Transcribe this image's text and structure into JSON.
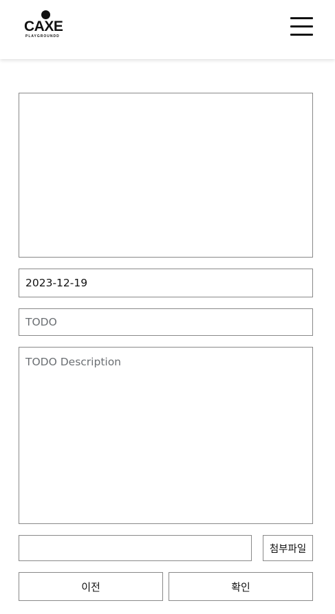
{
  "header": {
    "logo_text": "CAXE",
    "logo_subtext": "PLAYGROUNDD",
    "menu_icon": "hamburger-menu-icon"
  },
  "form": {
    "date_value": "2023-12-19",
    "todo_value": "",
    "todo_placeholder": "TODO",
    "description_value": "",
    "description_placeholder": "TODO Description",
    "attachment_filename": "",
    "attach_button_label": "첨부파일",
    "prev_button_label": "이전",
    "confirm_button_label": "확인"
  }
}
